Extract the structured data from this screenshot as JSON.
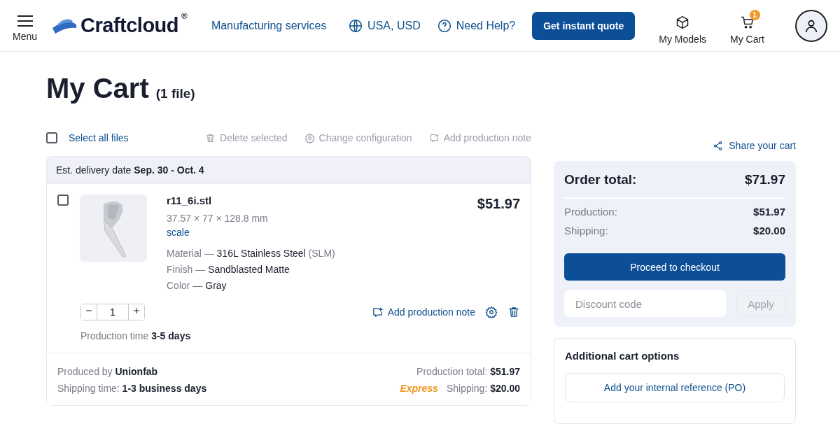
{
  "header": {
    "menu_label": "Menu",
    "logo": "Craftcloud",
    "logo_mark": "®",
    "nav_link": "Manufacturing services",
    "region": "USA, USD",
    "help": "Need Help?",
    "quote_button": "Get instant quote",
    "models_label": "My Models",
    "cart_label": "My Cart",
    "cart_badge": "1"
  },
  "page": {
    "title": "My Cart",
    "count": "(1 file)"
  },
  "toolbar": {
    "select_all": {
      "label": "Select all files",
      "checked": false
    },
    "actions": [
      {
        "kind": "delete",
        "label": "Delete selected",
        "disabled": true
      },
      {
        "kind": "config",
        "label": "Change configuration",
        "disabled": true
      },
      {
        "kind": "note",
        "label": "Add production note",
        "disabled": true
      }
    ],
    "share": "Share your cart"
  },
  "group": {
    "delivery": "Est. delivery date **Sep. 30 - Oct. 4**",
    "item": {
      "checked": false,
      "name": "r11_6i.stl",
      "dimensions": "37.57 × 77 × 128.8 mm",
      "scale_link": "scale",
      "price": "$51.97",
      "specs": [
        {
          "label": "Material —",
          "value": "316L Stainless Steel",
          "note": "(SLM)"
        },
        {
          "label": "Finish —",
          "value": "Sandblasted Matte"
        },
        {
          "label": "Color —",
          "value": "Gray"
        }
      ],
      "quantity": "1",
      "note_link": "Add production note",
      "production_time": "Production time **3-5 days**"
    },
    "producer": "Produced by **Unionfab**",
    "shipping_time": "Shipping time: **1-3 business days**",
    "production_total": "Production total: **$51.97**",
    "shipping_badge": "Express",
    "shipping": "Shipping: **$20.00**"
  },
  "summary": {
    "total_label": "Order total:",
    "total": "$71.97",
    "lines": [
      {
        "label": "Production:",
        "value": "$51.97"
      },
      {
        "label": "Shipping:",
        "value": "$20.00"
      }
    ],
    "checkout": "Proceed to checkout",
    "discount_placeholder": "Discount code",
    "apply": "Apply",
    "apply_disabled": true
  },
  "options": {
    "title": "Additional cart options",
    "po_button": "Add your internal reference (PO)"
  }
}
